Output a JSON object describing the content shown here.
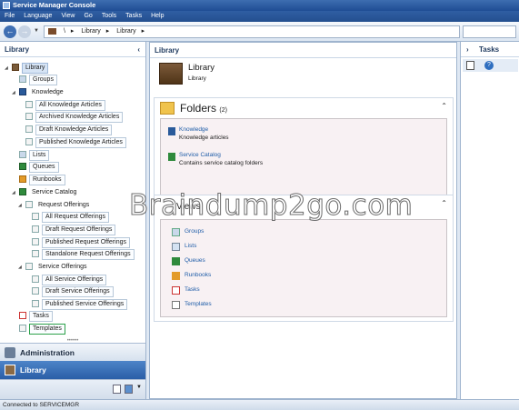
{
  "window": {
    "title": "Service Manager Console"
  },
  "menu": [
    "File",
    "Language",
    "View",
    "Go",
    "Tools",
    "Tasks",
    "Help"
  ],
  "address": {
    "crumbs": [
      "\\",
      "Library",
      "Library"
    ]
  },
  "left_pane": {
    "title": "Library",
    "tree": [
      {
        "label": "Library",
        "depth": 0,
        "icon": "library-icon"
      },
      {
        "label": "Groups",
        "depth": 1,
        "icon": "groups-icon"
      },
      {
        "label": "Knowledge",
        "depth": 1,
        "icon": "knowledge-icon"
      },
      {
        "label": "All Knowledge Articles",
        "depth": 2,
        "icon": "article-icon"
      },
      {
        "label": "Archived Knowledge Articles",
        "depth": 2,
        "icon": "article-icon"
      },
      {
        "label": "Draft Knowledge Articles",
        "depth": 2,
        "icon": "article-icon"
      },
      {
        "label": "Published Knowledge Articles",
        "depth": 2,
        "icon": "article-icon"
      },
      {
        "label": "Lists",
        "depth": 1,
        "icon": "lists-icon"
      },
      {
        "label": "Queues",
        "depth": 1,
        "icon": "queues-icon"
      },
      {
        "label": "Runbooks",
        "depth": 1,
        "icon": "runbooks-icon"
      },
      {
        "label": "Service Catalog",
        "depth": 1,
        "icon": "service-catalog-icon"
      },
      {
        "label": "Request Offerings",
        "depth": 2,
        "icon": "offering-icon"
      },
      {
        "label": "All Request Offerings",
        "depth": 3,
        "icon": "offering-icon"
      },
      {
        "label": "Draft Request Offerings",
        "depth": 3,
        "icon": "offering-icon"
      },
      {
        "label": "Published Request Offerings",
        "depth": 3,
        "icon": "offering-icon"
      },
      {
        "label": "Standalone Request Offerings",
        "depth": 3,
        "icon": "offering-icon"
      },
      {
        "label": "Service Offerings",
        "depth": 2,
        "icon": "offering-icon"
      },
      {
        "label": "All Service Offerings",
        "depth": 3,
        "icon": "offering-icon"
      },
      {
        "label": "Draft Service Offerings",
        "depth": 3,
        "icon": "offering-icon"
      },
      {
        "label": "Published Service Offerings",
        "depth": 3,
        "icon": "offering-icon"
      },
      {
        "label": "Tasks",
        "depth": 1,
        "icon": "tasks-icon"
      },
      {
        "label": "Templates",
        "depth": 1,
        "icon": "templates-icon"
      }
    ],
    "workspaces": [
      "Administration",
      "Library"
    ]
  },
  "center": {
    "pane_title": "Library",
    "header_title": "Library",
    "header_subtitle": "Library",
    "folders": {
      "title": "Folders",
      "count": "(2)",
      "items": [
        {
          "label": "Knowledge",
          "description": "Knowledge articles"
        },
        {
          "label": "Service Catalog",
          "description": "Contains service catalog folders"
        }
      ]
    },
    "views": {
      "title": "Views",
      "items": [
        "Groups",
        "Lists",
        "Queues",
        "Runbooks",
        "Tasks",
        "Templates"
      ]
    },
    "watermark": "Braindump2go.com"
  },
  "right_pane": {
    "title": "Tasks"
  },
  "status": {
    "text": "Connected to SERVICEMGR"
  }
}
